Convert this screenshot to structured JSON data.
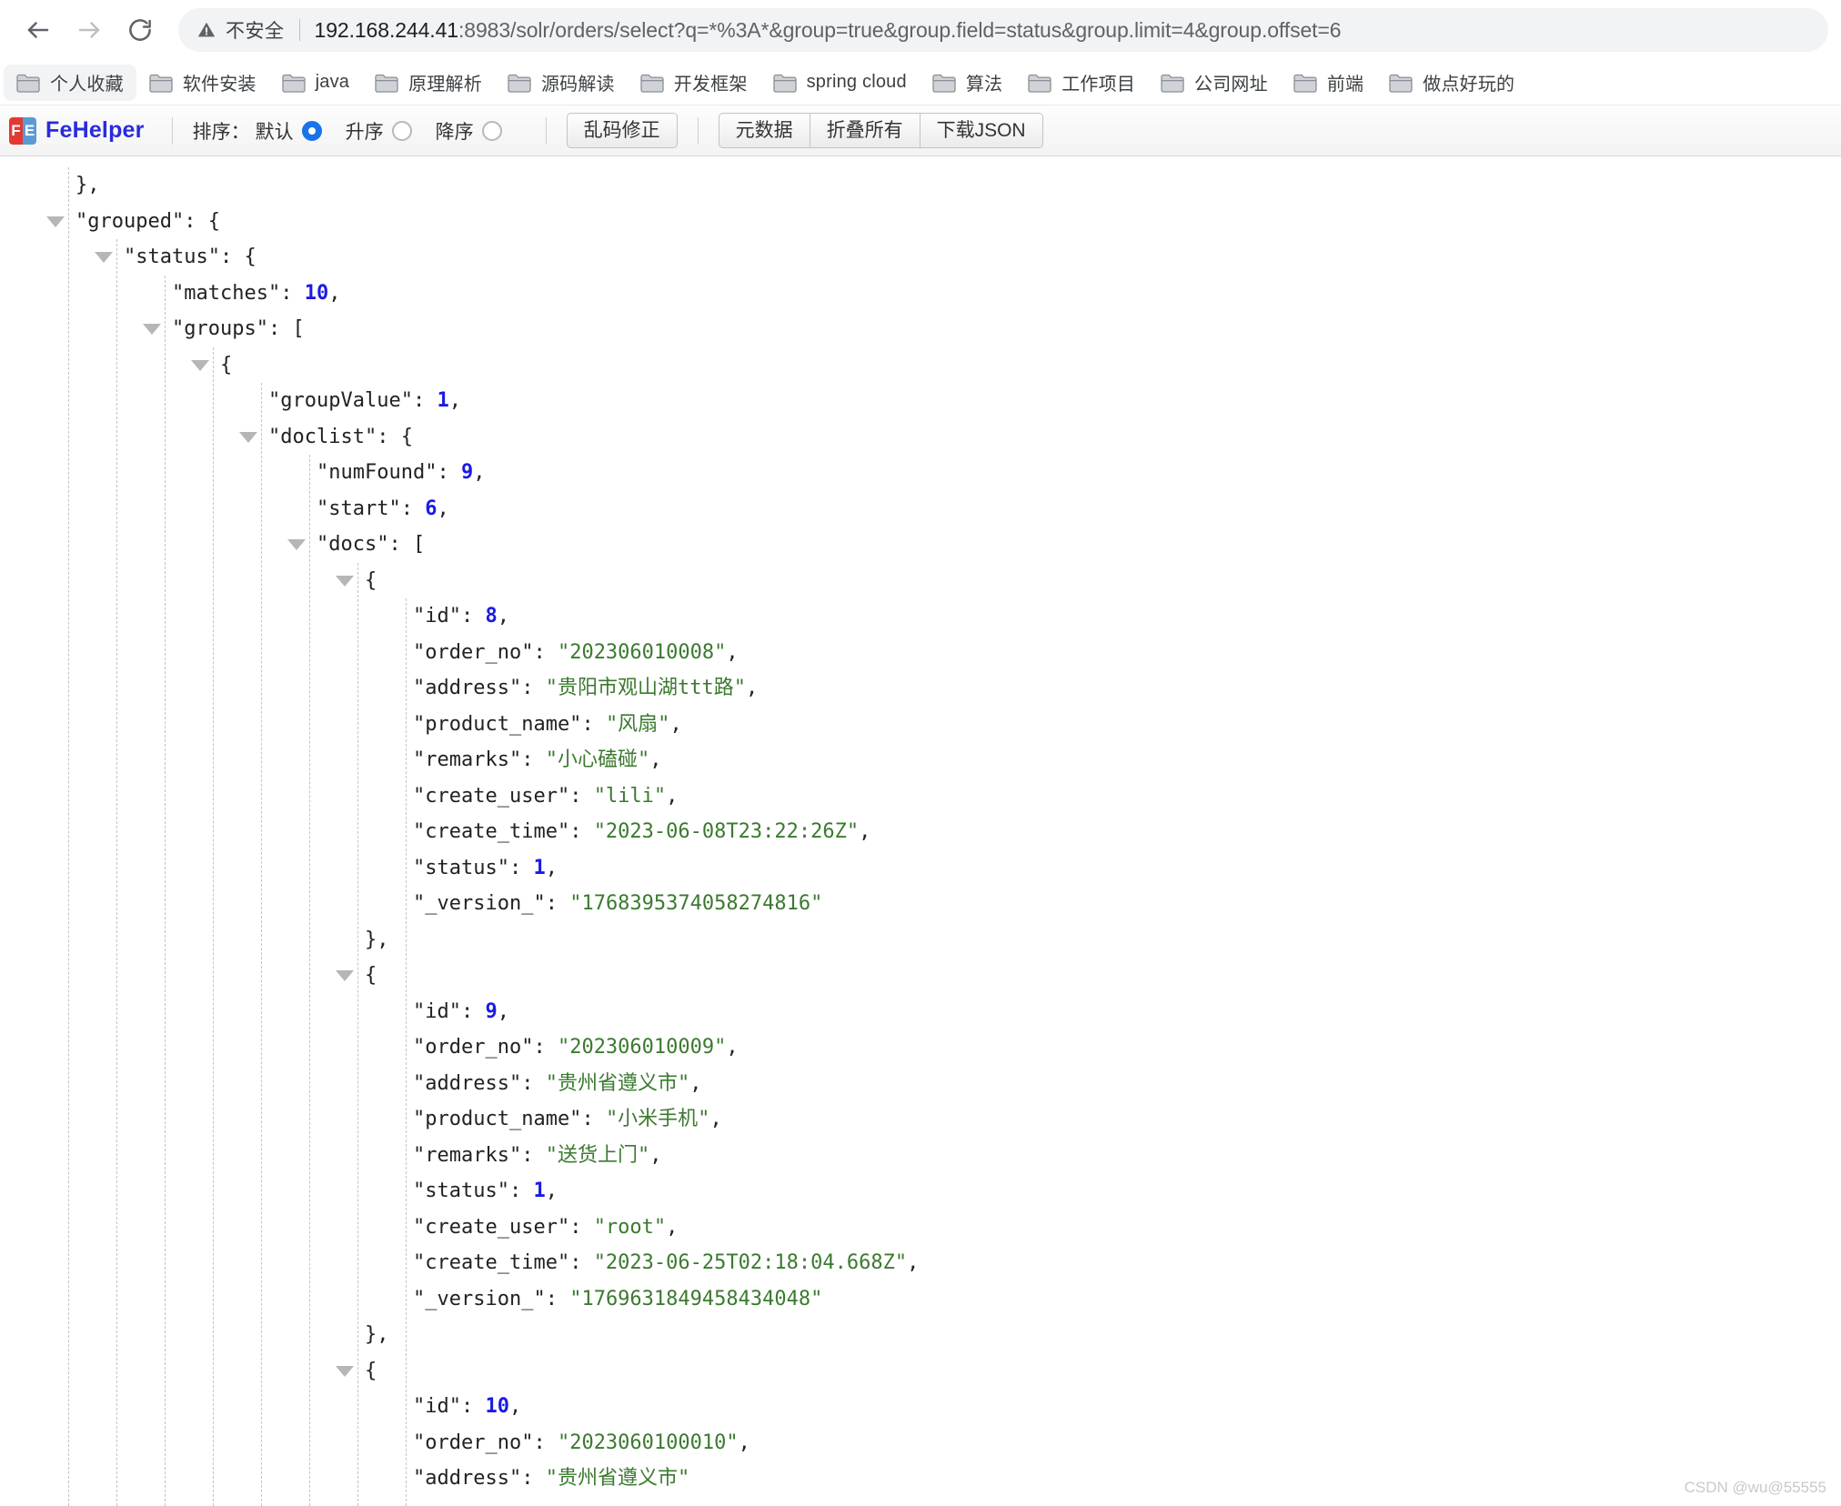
{
  "browser": {
    "back_label": "back",
    "forward_label": "forward",
    "reload_label": "reload",
    "security_text": "不安全",
    "url_host": "192.168.244.41",
    "url_rest": ":8983/solr/orders/select?q=*%3A*&group=true&group.field=status&group.limit=4&group.offset=6",
    "url_full": "192.168.244.41:8983/solr/orders/select?q=*%3A*&group=true&group.field=status&group.limit=4&group.offset=6"
  },
  "bookmarks": [
    {
      "label": "个人收藏",
      "active": true
    },
    {
      "label": "软件安装",
      "active": false
    },
    {
      "label": "java",
      "active": false
    },
    {
      "label": "原理解析",
      "active": false
    },
    {
      "label": "源码解读",
      "active": false
    },
    {
      "label": "开发框架",
      "active": false
    },
    {
      "label": "spring cloud",
      "active": false
    },
    {
      "label": "算法",
      "active": false
    },
    {
      "label": "工作项目",
      "active": false
    },
    {
      "label": "公司网址",
      "active": false
    },
    {
      "label": "前端",
      "active": false
    },
    {
      "label": "做点好玩的",
      "active": false
    }
  ],
  "fehelper": {
    "brand": "FeHelper",
    "logo_left": "F",
    "logo_right": "E",
    "sort_label": "排序：",
    "sort_options": [
      {
        "label": "默认",
        "checked": true
      },
      {
        "label": "升序",
        "checked": false
      },
      {
        "label": "降序",
        "checked": false
      }
    ],
    "fix_encoding_button": "乱码修正",
    "metadata_button": "元数据",
    "collapse_all_button": "折叠所有",
    "download_json_button": "下载JSON"
  },
  "json_lines": [
    {
      "indent": 1,
      "arrow": false,
      "segments": [
        {
          "t": "},",
          "c": "punct"
        }
      ]
    },
    {
      "indent": 1,
      "arrow": true,
      "segments": [
        {
          "t": "\"grouped\"",
          "c": "key"
        },
        {
          "t": ": {",
          "c": "punct"
        }
      ]
    },
    {
      "indent": 2,
      "arrow": true,
      "segments": [
        {
          "t": "\"status\"",
          "c": "key"
        },
        {
          "t": ": {",
          "c": "punct"
        }
      ]
    },
    {
      "indent": 3,
      "arrow": false,
      "segments": [
        {
          "t": "\"matches\"",
          "c": "key"
        },
        {
          "t": ": ",
          "c": "punct"
        },
        {
          "t": "10",
          "c": "num"
        },
        {
          "t": ",",
          "c": "punct"
        }
      ]
    },
    {
      "indent": 3,
      "arrow": true,
      "segments": [
        {
          "t": "\"groups\"",
          "c": "key"
        },
        {
          "t": ": [",
          "c": "punct"
        }
      ]
    },
    {
      "indent": 4,
      "arrow": true,
      "segments": [
        {
          "t": "{",
          "c": "punct"
        }
      ]
    },
    {
      "indent": 5,
      "arrow": false,
      "segments": [
        {
          "t": "\"groupValue\"",
          "c": "key"
        },
        {
          "t": ": ",
          "c": "punct"
        },
        {
          "t": "1",
          "c": "num"
        },
        {
          "t": ",",
          "c": "punct"
        }
      ]
    },
    {
      "indent": 5,
      "arrow": true,
      "segments": [
        {
          "t": "\"doclist\"",
          "c": "key"
        },
        {
          "t": ": {",
          "c": "punct"
        }
      ]
    },
    {
      "indent": 6,
      "arrow": false,
      "segments": [
        {
          "t": "\"numFound\"",
          "c": "key"
        },
        {
          "t": ": ",
          "c": "punct"
        },
        {
          "t": "9",
          "c": "num"
        },
        {
          "t": ",",
          "c": "punct"
        }
      ]
    },
    {
      "indent": 6,
      "arrow": false,
      "segments": [
        {
          "t": "\"start\"",
          "c": "key"
        },
        {
          "t": ": ",
          "c": "punct"
        },
        {
          "t": "6",
          "c": "num"
        },
        {
          "t": ",",
          "c": "punct"
        }
      ]
    },
    {
      "indent": 6,
      "arrow": true,
      "segments": [
        {
          "t": "\"docs\"",
          "c": "key"
        },
        {
          "t": ": [",
          "c": "punct"
        }
      ]
    },
    {
      "indent": 7,
      "arrow": true,
      "segments": [
        {
          "t": "{",
          "c": "punct"
        }
      ]
    },
    {
      "indent": 8,
      "arrow": false,
      "segments": [
        {
          "t": "\"id\"",
          "c": "key"
        },
        {
          "t": ": ",
          "c": "punct"
        },
        {
          "t": "8",
          "c": "num"
        },
        {
          "t": ",",
          "c": "punct"
        }
      ]
    },
    {
      "indent": 8,
      "arrow": false,
      "segments": [
        {
          "t": "\"order_no\"",
          "c": "key"
        },
        {
          "t": ": ",
          "c": "punct"
        },
        {
          "t": "\"202306010008\"",
          "c": "str"
        },
        {
          "t": ",",
          "c": "punct"
        }
      ]
    },
    {
      "indent": 8,
      "arrow": false,
      "segments": [
        {
          "t": "\"address\"",
          "c": "key"
        },
        {
          "t": ": ",
          "c": "punct"
        },
        {
          "t": "\"贵阳市观山湖ttt路\"",
          "c": "str"
        },
        {
          "t": ",",
          "c": "punct"
        }
      ]
    },
    {
      "indent": 8,
      "arrow": false,
      "segments": [
        {
          "t": "\"product_name\"",
          "c": "key"
        },
        {
          "t": ": ",
          "c": "punct"
        },
        {
          "t": "\"风扇\"",
          "c": "str"
        },
        {
          "t": ",",
          "c": "punct"
        }
      ]
    },
    {
      "indent": 8,
      "arrow": false,
      "segments": [
        {
          "t": "\"remarks\"",
          "c": "key"
        },
        {
          "t": ": ",
          "c": "punct"
        },
        {
          "t": "\"小心磕碰\"",
          "c": "str"
        },
        {
          "t": ",",
          "c": "punct"
        }
      ]
    },
    {
      "indent": 8,
      "arrow": false,
      "segments": [
        {
          "t": "\"create_user\"",
          "c": "key"
        },
        {
          "t": ": ",
          "c": "punct"
        },
        {
          "t": "\"lili\"",
          "c": "str"
        },
        {
          "t": ",",
          "c": "punct"
        }
      ]
    },
    {
      "indent": 8,
      "arrow": false,
      "segments": [
        {
          "t": "\"create_time\"",
          "c": "key"
        },
        {
          "t": ": ",
          "c": "punct"
        },
        {
          "t": "\"2023-06-08T23:22:26Z\"",
          "c": "str"
        },
        {
          "t": ",",
          "c": "punct"
        }
      ]
    },
    {
      "indent": 8,
      "arrow": false,
      "segments": [
        {
          "t": "\"status\"",
          "c": "key"
        },
        {
          "t": ": ",
          "c": "punct"
        },
        {
          "t": "1",
          "c": "num"
        },
        {
          "t": ",",
          "c": "punct"
        }
      ]
    },
    {
      "indent": 8,
      "arrow": false,
      "segments": [
        {
          "t": "\"_version_\"",
          "c": "key"
        },
        {
          "t": ": ",
          "c": "punct"
        },
        {
          "t": "\"1768395374058274816\"",
          "c": "str"
        }
      ]
    },
    {
      "indent": 7,
      "arrow": false,
      "segments": [
        {
          "t": "},",
          "c": "punct"
        }
      ]
    },
    {
      "indent": 7,
      "arrow": true,
      "segments": [
        {
          "t": "{",
          "c": "punct"
        }
      ]
    },
    {
      "indent": 8,
      "arrow": false,
      "segments": [
        {
          "t": "\"id\"",
          "c": "key"
        },
        {
          "t": ": ",
          "c": "punct"
        },
        {
          "t": "9",
          "c": "num"
        },
        {
          "t": ",",
          "c": "punct"
        }
      ]
    },
    {
      "indent": 8,
      "arrow": false,
      "segments": [
        {
          "t": "\"order_no\"",
          "c": "key"
        },
        {
          "t": ": ",
          "c": "punct"
        },
        {
          "t": "\"202306010009\"",
          "c": "str"
        },
        {
          "t": ",",
          "c": "punct"
        }
      ]
    },
    {
      "indent": 8,
      "arrow": false,
      "segments": [
        {
          "t": "\"address\"",
          "c": "key"
        },
        {
          "t": ": ",
          "c": "punct"
        },
        {
          "t": "\"贵州省遵义市\"",
          "c": "str"
        },
        {
          "t": ",",
          "c": "punct"
        }
      ]
    },
    {
      "indent": 8,
      "arrow": false,
      "segments": [
        {
          "t": "\"product_name\"",
          "c": "key"
        },
        {
          "t": ": ",
          "c": "punct"
        },
        {
          "t": "\"小米手机\"",
          "c": "str"
        },
        {
          "t": ",",
          "c": "punct"
        }
      ]
    },
    {
      "indent": 8,
      "arrow": false,
      "segments": [
        {
          "t": "\"remarks\"",
          "c": "key"
        },
        {
          "t": ": ",
          "c": "punct"
        },
        {
          "t": "\"送货上门\"",
          "c": "str"
        },
        {
          "t": ",",
          "c": "punct"
        }
      ]
    },
    {
      "indent": 8,
      "arrow": false,
      "segments": [
        {
          "t": "\"status\"",
          "c": "key"
        },
        {
          "t": ": ",
          "c": "punct"
        },
        {
          "t": "1",
          "c": "num"
        },
        {
          "t": ",",
          "c": "punct"
        }
      ]
    },
    {
      "indent": 8,
      "arrow": false,
      "segments": [
        {
          "t": "\"create_user\"",
          "c": "key"
        },
        {
          "t": ": ",
          "c": "punct"
        },
        {
          "t": "\"root\"",
          "c": "str"
        },
        {
          "t": ",",
          "c": "punct"
        }
      ]
    },
    {
      "indent": 8,
      "arrow": false,
      "segments": [
        {
          "t": "\"create_time\"",
          "c": "key"
        },
        {
          "t": ": ",
          "c": "punct"
        },
        {
          "t": "\"2023-06-25T02:18:04.668Z\"",
          "c": "str"
        },
        {
          "t": ",",
          "c": "punct"
        }
      ]
    },
    {
      "indent": 8,
      "arrow": false,
      "segments": [
        {
          "t": "\"_version_\"",
          "c": "key"
        },
        {
          "t": ": ",
          "c": "punct"
        },
        {
          "t": "\"1769631849458434048\"",
          "c": "str"
        }
      ]
    },
    {
      "indent": 7,
      "arrow": false,
      "segments": [
        {
          "t": "},",
          "c": "punct"
        }
      ]
    },
    {
      "indent": 7,
      "arrow": true,
      "segments": [
        {
          "t": "{",
          "c": "punct"
        }
      ]
    },
    {
      "indent": 8,
      "arrow": false,
      "segments": [
        {
          "t": "\"id\"",
          "c": "key"
        },
        {
          "t": ": ",
          "c": "punct"
        },
        {
          "t": "10",
          "c": "num"
        },
        {
          "t": ",",
          "c": "punct"
        }
      ]
    },
    {
      "indent": 8,
      "arrow": false,
      "segments": [
        {
          "t": "\"order_no\"",
          "c": "key"
        },
        {
          "t": ": ",
          "c": "punct"
        },
        {
          "t": "\"2023060100010\"",
          "c": "str"
        },
        {
          "t": ",",
          "c": "punct"
        }
      ]
    },
    {
      "indent": 8,
      "arrow": false,
      "segments": [
        {
          "t": "\"address\"",
          "c": "key"
        },
        {
          "t": ": ",
          "c": "punct"
        },
        {
          "t": "\"贵州省遵义市\"",
          "c": "str"
        }
      ]
    }
  ],
  "watermark": "CSDN @wu@55555"
}
